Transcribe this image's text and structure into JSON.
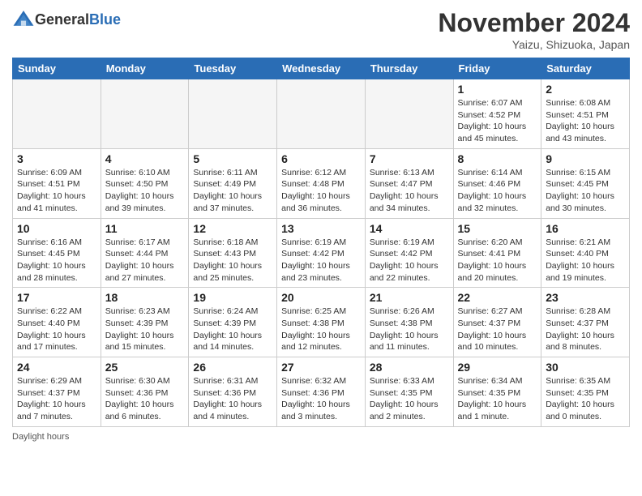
{
  "header": {
    "logo_general": "General",
    "logo_blue": "Blue",
    "month_title": "November 2024",
    "location": "Yaizu, Shizuoka, Japan"
  },
  "weekdays": [
    "Sunday",
    "Monday",
    "Tuesday",
    "Wednesday",
    "Thursday",
    "Friday",
    "Saturday"
  ],
  "footer": {
    "daylight_hours": "Daylight hours"
  },
  "weeks": [
    [
      {
        "day": "",
        "info": ""
      },
      {
        "day": "",
        "info": ""
      },
      {
        "day": "",
        "info": ""
      },
      {
        "day": "",
        "info": ""
      },
      {
        "day": "",
        "info": ""
      },
      {
        "day": "1",
        "info": "Sunrise: 6:07 AM\nSunset: 4:52 PM\nDaylight: 10 hours and 45 minutes."
      },
      {
        "day": "2",
        "info": "Sunrise: 6:08 AM\nSunset: 4:51 PM\nDaylight: 10 hours and 43 minutes."
      }
    ],
    [
      {
        "day": "3",
        "info": "Sunrise: 6:09 AM\nSunset: 4:51 PM\nDaylight: 10 hours and 41 minutes."
      },
      {
        "day": "4",
        "info": "Sunrise: 6:10 AM\nSunset: 4:50 PM\nDaylight: 10 hours and 39 minutes."
      },
      {
        "day": "5",
        "info": "Sunrise: 6:11 AM\nSunset: 4:49 PM\nDaylight: 10 hours and 37 minutes."
      },
      {
        "day": "6",
        "info": "Sunrise: 6:12 AM\nSunset: 4:48 PM\nDaylight: 10 hours and 36 minutes."
      },
      {
        "day": "7",
        "info": "Sunrise: 6:13 AM\nSunset: 4:47 PM\nDaylight: 10 hours and 34 minutes."
      },
      {
        "day": "8",
        "info": "Sunrise: 6:14 AM\nSunset: 4:46 PM\nDaylight: 10 hours and 32 minutes."
      },
      {
        "day": "9",
        "info": "Sunrise: 6:15 AM\nSunset: 4:45 PM\nDaylight: 10 hours and 30 minutes."
      }
    ],
    [
      {
        "day": "10",
        "info": "Sunrise: 6:16 AM\nSunset: 4:45 PM\nDaylight: 10 hours and 28 minutes."
      },
      {
        "day": "11",
        "info": "Sunrise: 6:17 AM\nSunset: 4:44 PM\nDaylight: 10 hours and 27 minutes."
      },
      {
        "day": "12",
        "info": "Sunrise: 6:18 AM\nSunset: 4:43 PM\nDaylight: 10 hours and 25 minutes."
      },
      {
        "day": "13",
        "info": "Sunrise: 6:19 AM\nSunset: 4:42 PM\nDaylight: 10 hours and 23 minutes."
      },
      {
        "day": "14",
        "info": "Sunrise: 6:19 AM\nSunset: 4:42 PM\nDaylight: 10 hours and 22 minutes."
      },
      {
        "day": "15",
        "info": "Sunrise: 6:20 AM\nSunset: 4:41 PM\nDaylight: 10 hours and 20 minutes."
      },
      {
        "day": "16",
        "info": "Sunrise: 6:21 AM\nSunset: 4:40 PM\nDaylight: 10 hours and 19 minutes."
      }
    ],
    [
      {
        "day": "17",
        "info": "Sunrise: 6:22 AM\nSunset: 4:40 PM\nDaylight: 10 hours and 17 minutes."
      },
      {
        "day": "18",
        "info": "Sunrise: 6:23 AM\nSunset: 4:39 PM\nDaylight: 10 hours and 15 minutes."
      },
      {
        "day": "19",
        "info": "Sunrise: 6:24 AM\nSunset: 4:39 PM\nDaylight: 10 hours and 14 minutes."
      },
      {
        "day": "20",
        "info": "Sunrise: 6:25 AM\nSunset: 4:38 PM\nDaylight: 10 hours and 12 minutes."
      },
      {
        "day": "21",
        "info": "Sunrise: 6:26 AM\nSunset: 4:38 PM\nDaylight: 10 hours and 11 minutes."
      },
      {
        "day": "22",
        "info": "Sunrise: 6:27 AM\nSunset: 4:37 PM\nDaylight: 10 hours and 10 minutes."
      },
      {
        "day": "23",
        "info": "Sunrise: 6:28 AM\nSunset: 4:37 PM\nDaylight: 10 hours and 8 minutes."
      }
    ],
    [
      {
        "day": "24",
        "info": "Sunrise: 6:29 AM\nSunset: 4:37 PM\nDaylight: 10 hours and 7 minutes."
      },
      {
        "day": "25",
        "info": "Sunrise: 6:30 AM\nSunset: 4:36 PM\nDaylight: 10 hours and 6 minutes."
      },
      {
        "day": "26",
        "info": "Sunrise: 6:31 AM\nSunset: 4:36 PM\nDaylight: 10 hours and 4 minutes."
      },
      {
        "day": "27",
        "info": "Sunrise: 6:32 AM\nSunset: 4:36 PM\nDaylight: 10 hours and 3 minutes."
      },
      {
        "day": "28",
        "info": "Sunrise: 6:33 AM\nSunset: 4:35 PM\nDaylight: 10 hours and 2 minutes."
      },
      {
        "day": "29",
        "info": "Sunrise: 6:34 AM\nSunset: 4:35 PM\nDaylight: 10 hours and 1 minute."
      },
      {
        "day": "30",
        "info": "Sunrise: 6:35 AM\nSunset: 4:35 PM\nDaylight: 10 hours and 0 minutes."
      }
    ]
  ]
}
